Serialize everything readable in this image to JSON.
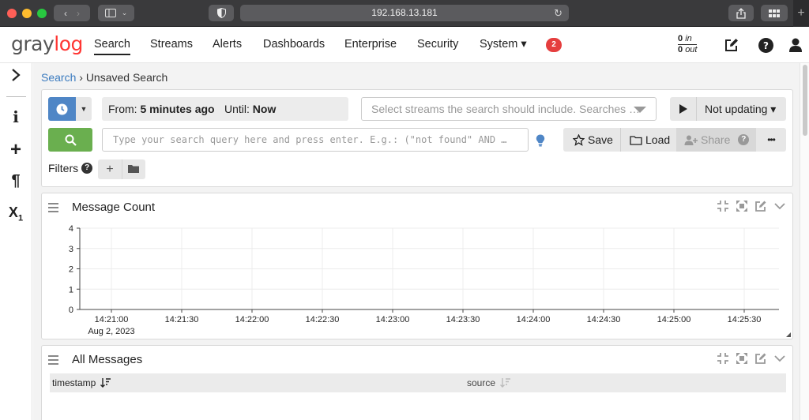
{
  "browser": {
    "url": "192.168.13.181"
  },
  "nav": {
    "logo_part1": "gray",
    "logo_part2": "log",
    "items": [
      "Search",
      "Streams",
      "Alerts",
      "Dashboards",
      "Enterprise",
      "Security",
      "System ▾"
    ],
    "active": "Search",
    "notification_count": "2",
    "throughput": {
      "in_value": "0",
      "in_label": "in",
      "out_value": "0",
      "out_label": "out"
    }
  },
  "breadcrumb": {
    "root": "Search",
    "separator": "›",
    "current": "Unsaved Search"
  },
  "search_bar": {
    "from_label": "From:",
    "from_value": "5 minutes ago",
    "until_label": "Until:",
    "until_value": "Now",
    "streams_placeholder": "Select streams the search should include. Searches …",
    "refresh_label": "Not updating ▾",
    "query_placeholder": "Type your search query here and press enter. E.g.: (\"not found\" AND …",
    "save_label": "Save",
    "load_label": "Load",
    "share_label": "Share",
    "more_label": "•••",
    "filters_label": "Filters",
    "help_mark": "?"
  },
  "widgets": {
    "message_count": {
      "title": "Message Count",
      "chart_data": {
        "type": "line",
        "title": "",
        "xlabel": "",
        "ylabel": "",
        "x": [
          "14:21:00",
          "14:21:30",
          "14:22:00",
          "14:22:30",
          "14:23:00",
          "14:23:30",
          "14:24:00",
          "14:24:30",
          "14:25:00",
          "14:25:30"
        ],
        "x_sublabel": "Aug 2, 2023",
        "y_ticks": [
          0,
          1,
          2,
          3,
          4
        ],
        "ylim": [
          0,
          4
        ],
        "series": [],
        "grid": true
      }
    },
    "all_messages": {
      "title": "All Messages",
      "columns": [
        "timestamp",
        "source"
      ]
    }
  },
  "colors": {
    "accent_blue": "#4f86c6",
    "search_green": "#6aaf4f",
    "logo_red": "#ff3633",
    "badge_red": "#e53e3e"
  }
}
